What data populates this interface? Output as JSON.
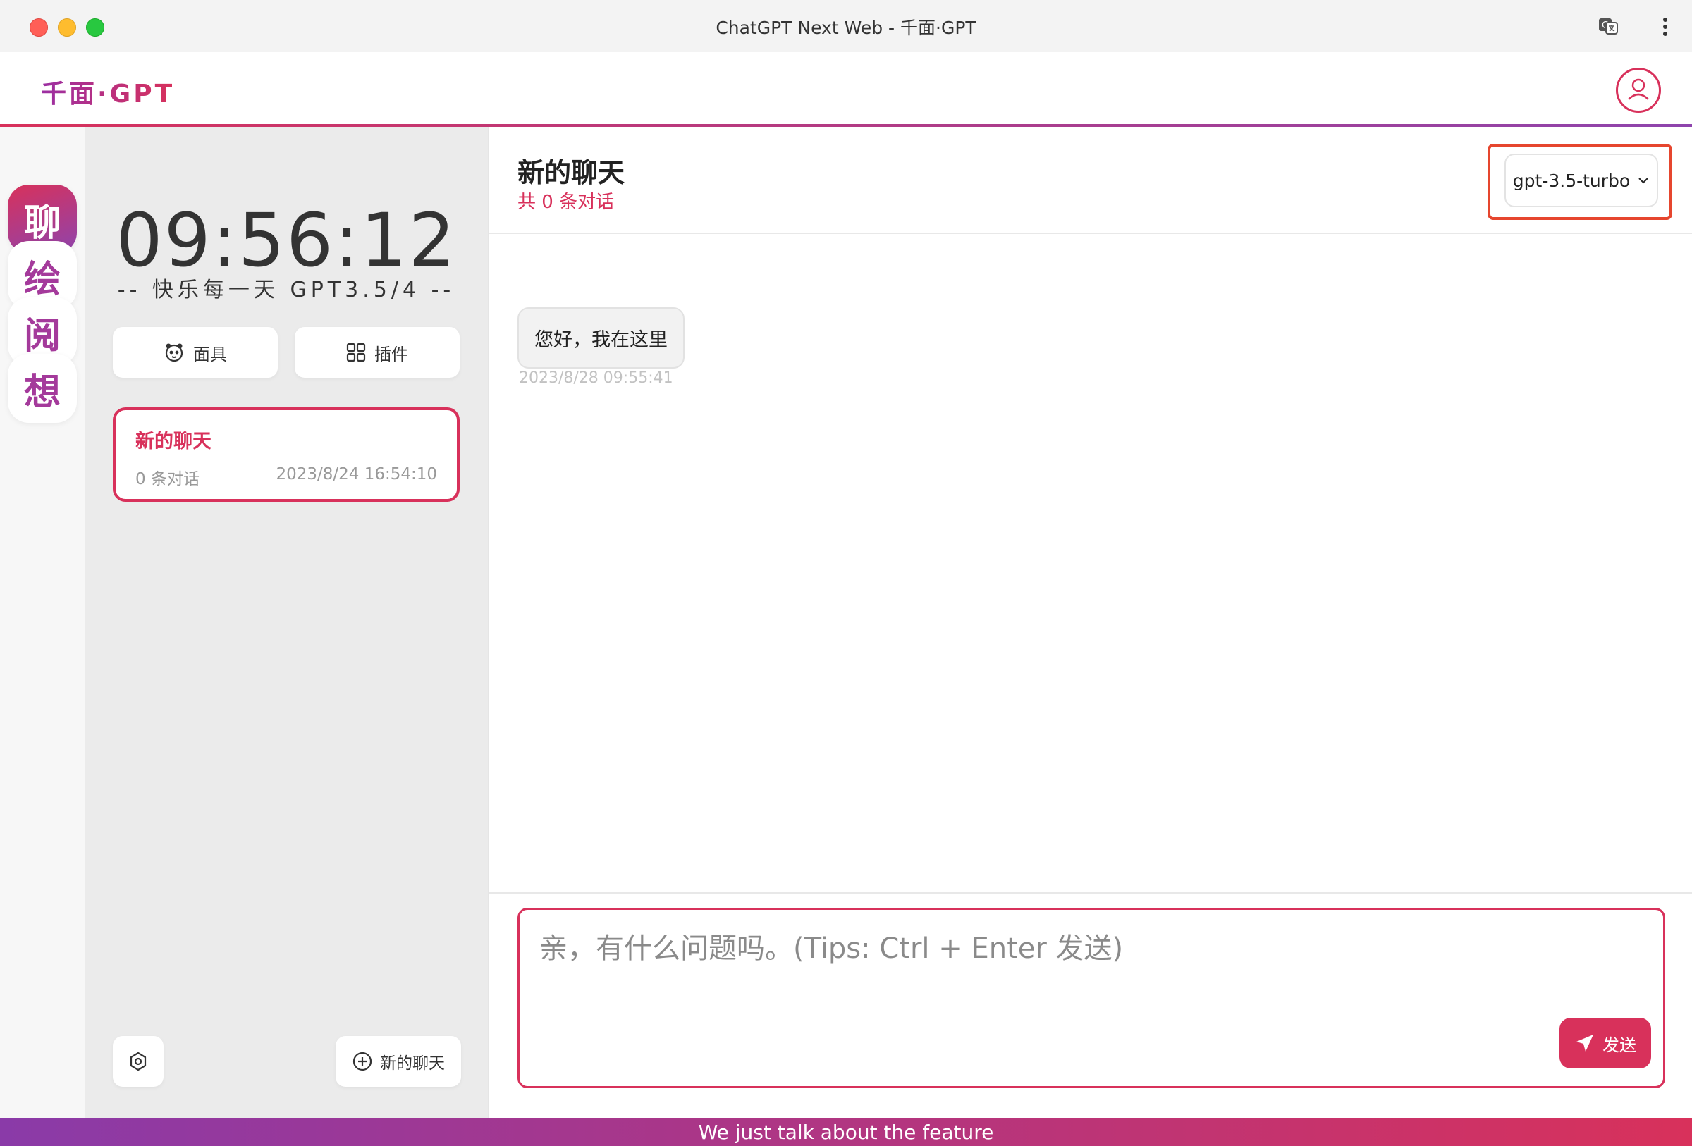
{
  "window": {
    "title": "ChatGPT Next Web - 千面·GPT"
  },
  "app": {
    "logo": "千面·GPT"
  },
  "rail": {
    "items": [
      {
        "label": "聊",
        "active": true
      },
      {
        "label": "绘",
        "active": false
      },
      {
        "label": "阅",
        "active": false
      },
      {
        "label": "想",
        "active": false
      }
    ]
  },
  "sidebar": {
    "clock": "09:56:12",
    "slogan": "-- 快乐每一天 GPT3.5/4 --",
    "mask_label": "面具",
    "plugin_label": "插件",
    "chats": [
      {
        "title": "新的聊天",
        "count": "0 条对话",
        "time": "2023/8/24 16:54:10"
      }
    ],
    "new_chat_label": "新的聊天"
  },
  "main": {
    "title": "新的聊天",
    "subtitle": "共 0 条对话",
    "model": "gpt-3.5-turbo",
    "messages": [
      {
        "text": "您好，我在这里",
        "time": "2023/8/28 09:55:41"
      }
    ],
    "input_placeholder": "亲，有什么问题吗。(Tips: Ctrl + Enter 发送)",
    "send_label": "发送"
  },
  "footer": {
    "text": "We just talk about the feature"
  },
  "colors": {
    "accent": "#d8315b",
    "accent2": "#8e44ad",
    "highlight": "#e6462e"
  }
}
